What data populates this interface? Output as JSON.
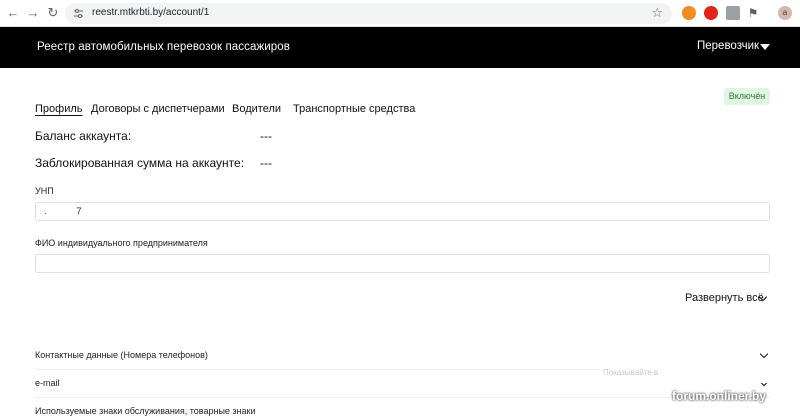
{
  "browser": {
    "url": "reestr.mtkrbti.by/account/1",
    "avatar_letter": "a"
  },
  "header": {
    "title": "Реестр автомобильных перевозок пассажиров",
    "role": "Перевозчик"
  },
  "tabs": [
    {
      "label": "Профиль",
      "active": true
    },
    {
      "label": "Договоры с диспетчерами",
      "active": false
    },
    {
      "label": "Водители",
      "active": false
    },
    {
      "label": "Транспортные средства",
      "active": false
    }
  ],
  "status_badge": "Включён",
  "account": {
    "balance_label": "Баланс аккаунта:",
    "balance_value": "---",
    "blocked_label": "Заблокированная сумма на аккаунте:",
    "blocked_value": "---"
  },
  "fields": {
    "unp_label": "УНП",
    "unp_value": ".            7",
    "fio_label": "ФИО индивидуального предпринимателя",
    "fio_value": ""
  },
  "expand_all_label": "Развернуть всё",
  "sections": [
    {
      "title": "Контактные данные (Номера телефонов)"
    },
    {
      "title": "e-mail"
    },
    {
      "title": "Используемые знаки обслуживания, товарные знаки"
    }
  ],
  "overlay_text": "Показывайте в",
  "watermark": "forum.onliner.by"
}
